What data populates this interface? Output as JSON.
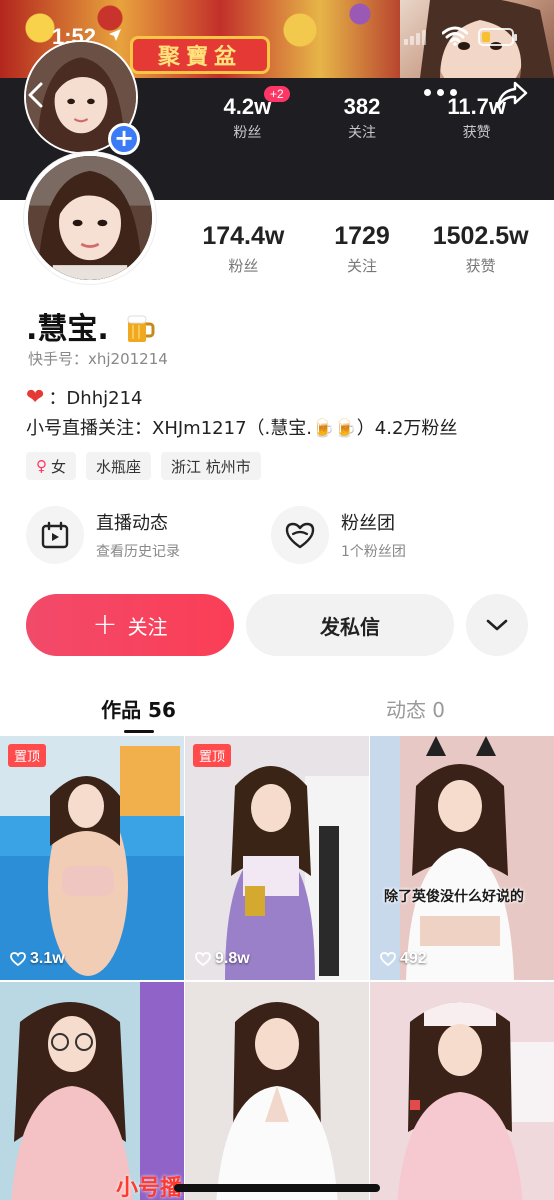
{
  "status_bar": {
    "time": "1:52",
    "battery_level": 0.3
  },
  "banner": {
    "plaque_text": "聚寶盆"
  },
  "header_stats": [
    {
      "value": "4.2w",
      "label": "粉丝",
      "badge": "+2"
    },
    {
      "value": "382",
      "label": "关注"
    },
    {
      "value": "11.7w",
      "label": "获赞"
    }
  ],
  "profile": {
    "nickname": ".慧宝.",
    "kwai_id": "快手号：xhj201214",
    "bio_line1": "：Dhhj214",
    "bio_line2": "小号直播关注：XHJm1217（.慧宝.🍺🍺）4.2万粉丝"
  },
  "stats": [
    {
      "value": "174.4w",
      "label": "粉丝"
    },
    {
      "value": "1729",
      "label": "关注"
    },
    {
      "value": "1502.5w",
      "label": "获赞"
    }
  ],
  "tags": [
    {
      "label": "女",
      "icon": "female-icon"
    },
    {
      "label": "水瓶座"
    },
    {
      "label": "浙江 杭州市"
    }
  ],
  "features": [
    {
      "title": "直播动态",
      "subtitle": "查看历史记录",
      "icon": "live-calendar-icon"
    },
    {
      "title": "粉丝团",
      "subtitle": "1个粉丝团",
      "icon": "fan-heart-icon"
    }
  ],
  "actions": {
    "follow": "关注",
    "message": "发私信"
  },
  "tabs": [
    {
      "label": "作品 56",
      "active": true
    },
    {
      "label": "动态 0",
      "active": false
    }
  ],
  "works": [
    {
      "pinned": "置顶",
      "likes": "3.1w"
    },
    {
      "pinned": "置顶",
      "likes": "9.8w"
    },
    {
      "likes": "492",
      "caption": "除了英俊没什么好说的"
    },
    {},
    {},
    {}
  ],
  "watermark": "小号播",
  "colors": {
    "accent": "#fe3666",
    "follow_button": "#f24a6a",
    "header_dark": "#1e1e22",
    "add_badge": "#3b7bf6"
  }
}
